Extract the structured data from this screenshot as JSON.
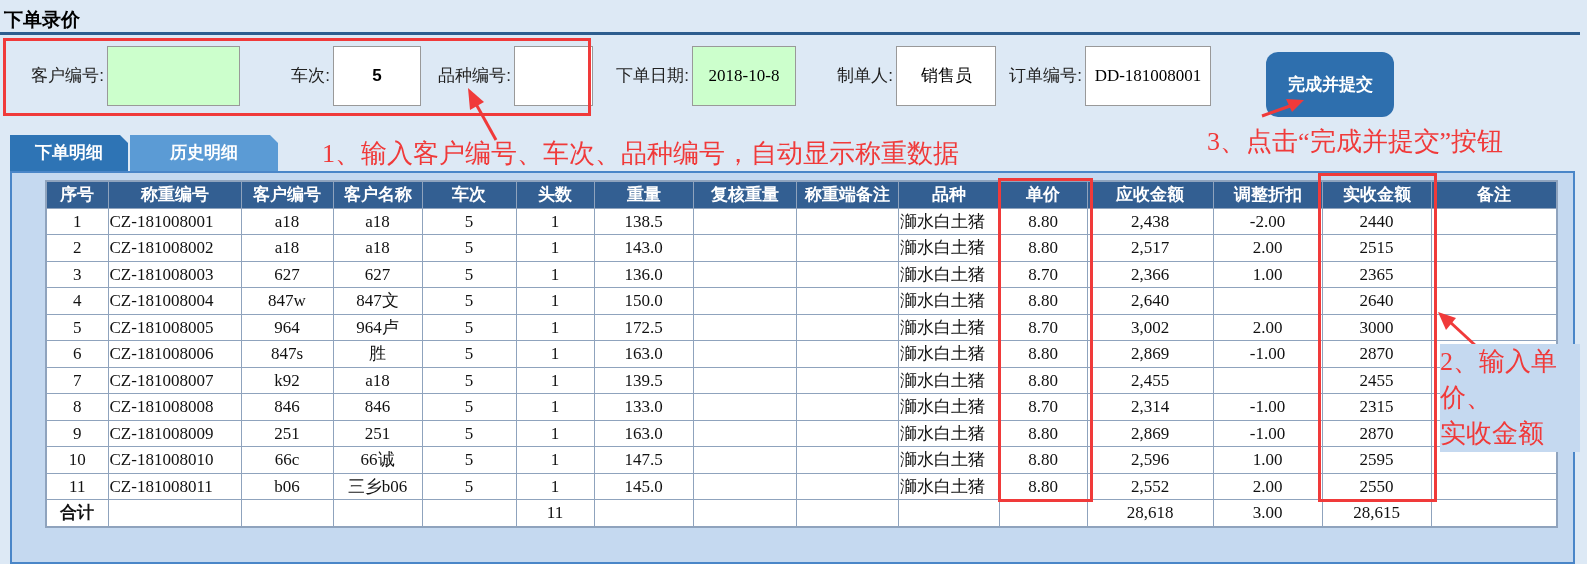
{
  "title": "下单录价",
  "form": {
    "fields": [
      {
        "label": "客户编号:",
        "color": "#ccffcc"
      },
      {
        "label": "车次:",
        "value": "5",
        "color": "#ffffff",
        "bold": true
      },
      {
        "label": "品种编号:",
        "color": "#ffffff"
      },
      {
        "label": "下单日期:",
        "value": "2018-10-8",
        "color": "#ccffcc",
        "bold": false
      },
      {
        "label": "制单人:",
        "value": "销售员",
        "color": "#ffffff",
        "bold": false
      },
      {
        "label": "订单编号:",
        "value": "DD-181008001",
        "color": "#ffffff",
        "bold": false
      }
    ],
    "submit_button": "完成并提交"
  },
  "tabs": [
    {
      "label": "下单明细",
      "selected": true
    },
    {
      "label": "历史明细",
      "selected": false
    }
  ],
  "table": {
    "columns": [
      "序号",
      "称重编号",
      "客户编号",
      "客户名称",
      "车次",
      "头数",
      "重量",
      "复核重量",
      "称重端备注",
      "品种",
      "单价",
      "应收金额",
      "调整折扣",
      "实收金额",
      "备注"
    ],
    "rows": [
      [
        "1",
        "CZ-181008001",
        "a18",
        "a18",
        "5",
        "1",
        "138.5",
        null,
        null,
        "溮水白土猪",
        "8.80",
        "2,438",
        "-2.00",
        "2440",
        null
      ],
      [
        "2",
        "CZ-181008002",
        "a18",
        "a18",
        "5",
        "1",
        "143.0",
        null,
        null,
        "溮水白土猪",
        "8.80",
        "2,517",
        "2.00",
        "2515",
        null
      ],
      [
        "3",
        "CZ-181008003",
        "627",
        "627",
        "5",
        "1",
        "136.0",
        null,
        null,
        "溮水白土猪",
        "8.70",
        "2,366",
        "1.00",
        "2365",
        null
      ],
      [
        "4",
        "CZ-181008004",
        "847w",
        "847文",
        "5",
        "1",
        "150.0",
        null,
        null,
        "溮水白土猪",
        "8.80",
        "2,640",
        null,
        "2640",
        null
      ],
      [
        "5",
        "CZ-181008005",
        "964",
        "964卢",
        "5",
        "1",
        "172.5",
        null,
        null,
        "溮水白土猪",
        "8.70",
        "3,002",
        "2.00",
        "3000",
        null
      ],
      [
        "6",
        "CZ-181008006",
        "847s",
        "胜",
        "5",
        "1",
        "163.0",
        null,
        null,
        "溮水白土猪",
        "8.80",
        "2,869",
        "-1.00",
        "2870",
        null
      ],
      [
        "7",
        "CZ-181008007",
        "k92",
        "a18",
        "5",
        "1",
        "139.5",
        null,
        null,
        "溮水白土猪",
        "8.80",
        "2,455",
        null,
        "2455",
        null
      ],
      [
        "8",
        "CZ-181008008",
        "846",
        "846",
        "5",
        "1",
        "133.0",
        null,
        null,
        "溮水白土猪",
        "8.70",
        "2,314",
        "-1.00",
        "2315",
        null
      ],
      [
        "9",
        "CZ-181008009",
        "251",
        "251",
        "5",
        "1",
        "163.0",
        null,
        null,
        "溮水白土猪",
        "8.80",
        "2,869",
        "-1.00",
        "2870",
        null
      ],
      [
        "10",
        "CZ-181008010",
        "66c",
        "66诚",
        "5",
        "1",
        "147.5",
        null,
        null,
        "溮水白土猪",
        "8.80",
        "2,596",
        "1.00",
        "2595",
        null
      ],
      [
        "11",
        "CZ-181008011",
        "b06",
        "三乡b06",
        "5",
        "1",
        "145.0",
        null,
        null,
        "溮水白土猪",
        "8.80",
        "2,552",
        "2.00",
        "2550",
        null
      ]
    ],
    "total_row": {
      "label": "合计",
      "head_count": "11",
      "receivable": "28,618",
      "discount": "3.00",
      "received": "28,615"
    }
  },
  "annotations": [
    {
      "lines": [
        "1、输入客户编号、车次、品种编号，自动显示称重数据"
      ]
    },
    {
      "lines": [
        "3、点击“完成并提交”按钮"
      ]
    },
    {
      "lines": [
        "2、输入单",
        "价、",
        "实收金额"
      ]
    }
  ]
}
